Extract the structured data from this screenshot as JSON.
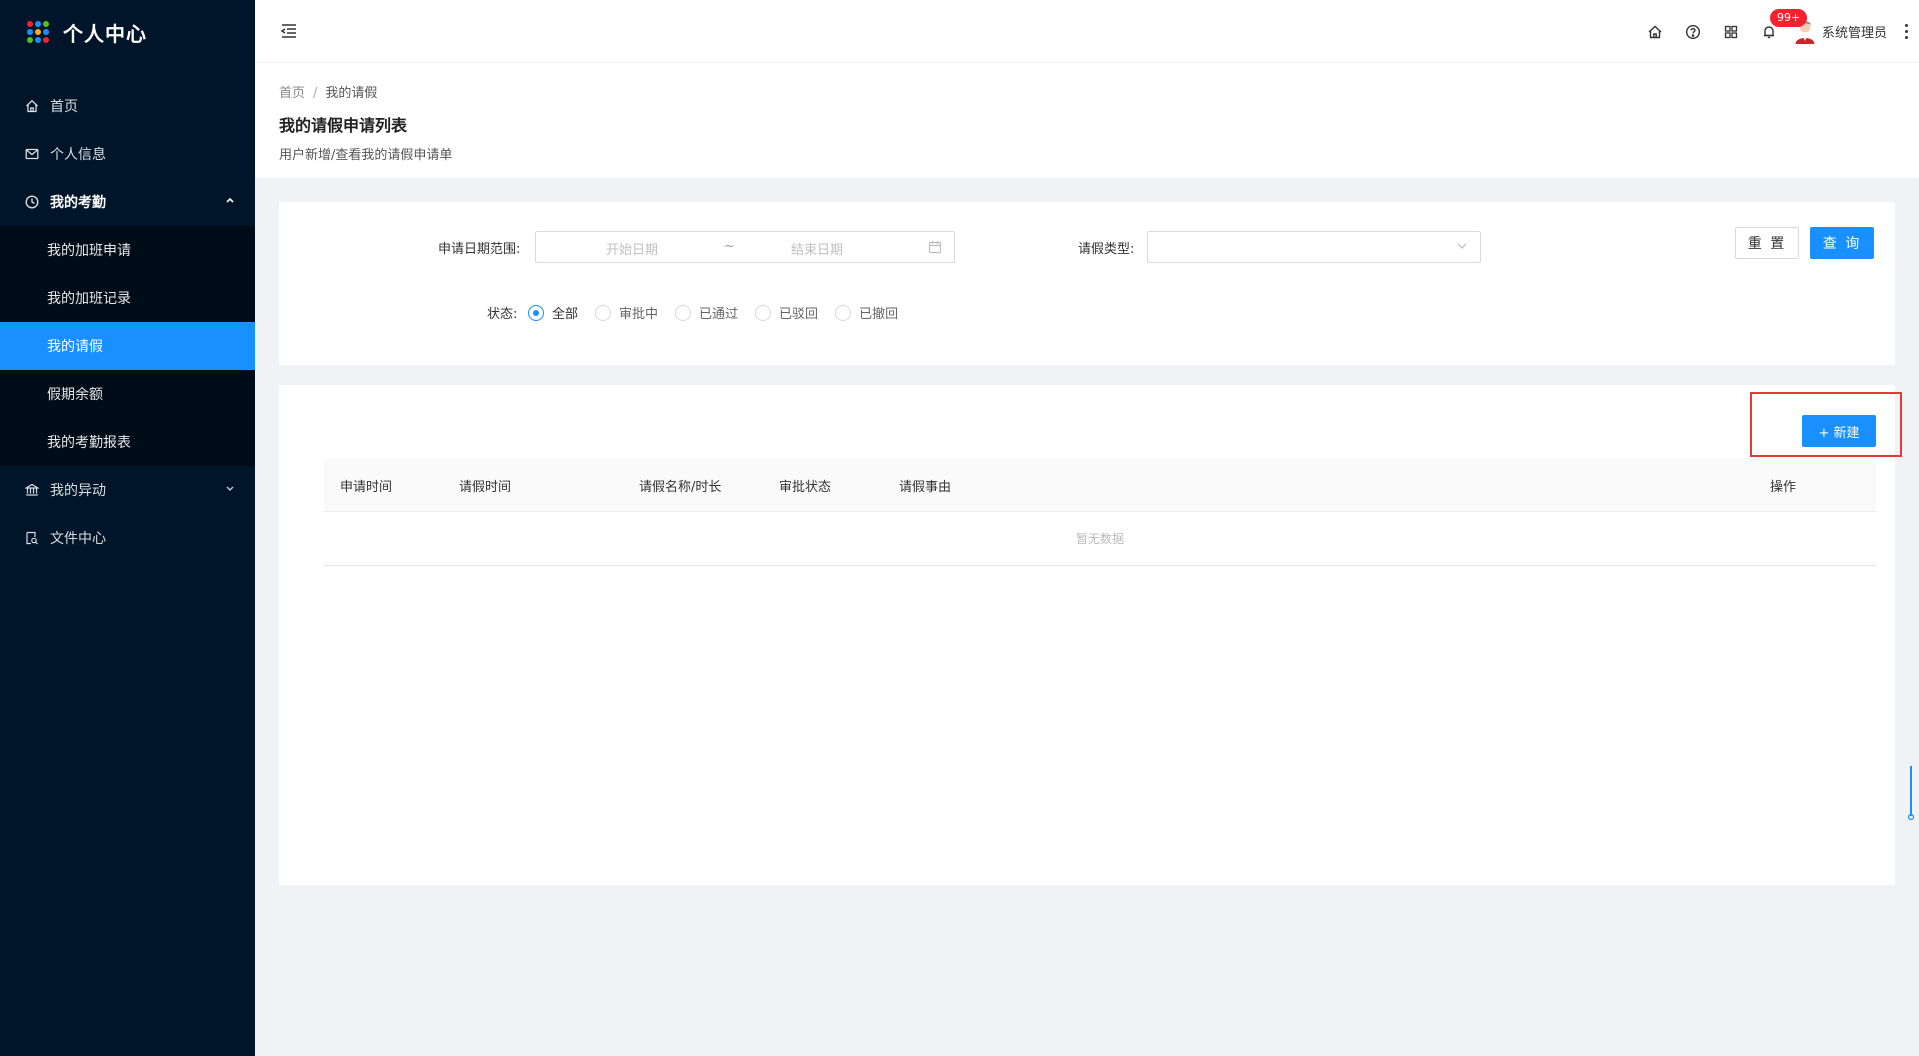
{
  "app": {
    "title": "个人中心"
  },
  "sidebar": {
    "items": [
      {
        "label": "首页",
        "icon": "home-icon"
      },
      {
        "label": "个人信息",
        "icon": "mail-icon"
      },
      {
        "label": "我的考勤",
        "icon": "clock-icon",
        "expanded": true,
        "children": [
          {
            "label": "我的加班申请"
          },
          {
            "label": "我的加班记录"
          },
          {
            "label": "我的请假",
            "active": true
          },
          {
            "label": "假期余额"
          },
          {
            "label": "我的考勤报表"
          }
        ]
      },
      {
        "label": "我的异动",
        "icon": "bank-icon",
        "expanded": false
      },
      {
        "label": "文件中心",
        "icon": "file-search-icon"
      }
    ]
  },
  "header": {
    "notification_count": "99+",
    "user_name": "系统管理员"
  },
  "breadcrumb": {
    "home": "首页",
    "separator": "/",
    "current": "我的请假"
  },
  "page": {
    "title": "我的请假申请列表",
    "subtitle": "用户新增/查看我的请假申请单"
  },
  "search": {
    "date_range_label": "申请日期范围:",
    "start_placeholder": "开始日期",
    "range_sep": "~",
    "end_placeholder": "结束日期",
    "leave_type_label": "请假类型:",
    "leave_type_value": "",
    "status_label": "状态:",
    "status_options": [
      "全部",
      "审批中",
      "已通过",
      "已驳回",
      "已撤回"
    ],
    "status_selected": "全部",
    "reset_label": "重 置",
    "query_label": "查 询"
  },
  "table": {
    "new_button": "+ 新建",
    "columns": [
      "申请时间",
      "请假时间",
      "请假名称/时长",
      "审批状态",
      "请假事由",
      "操作"
    ],
    "rows": [],
    "empty_text": "暂无数据"
  },
  "colors": {
    "sidebar_bg": "#001529",
    "submenu_bg": "#000c17",
    "primary": "#1890ff",
    "badge": "#f5222d",
    "highlight": "#e53935"
  }
}
